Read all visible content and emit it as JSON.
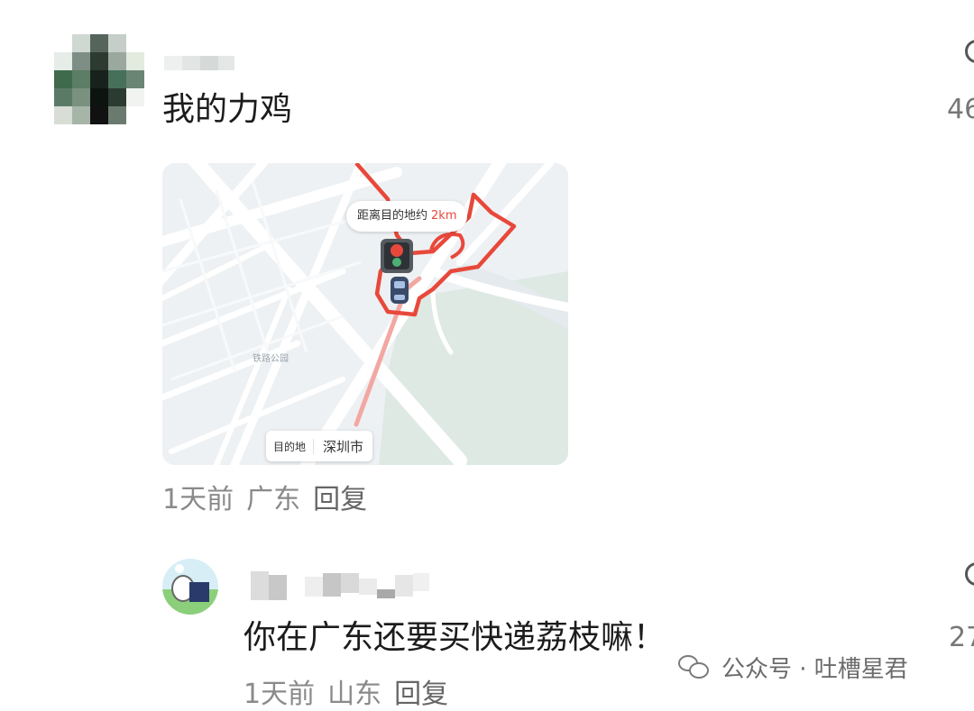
{
  "comments": [
    {
      "text": "我的力鸡",
      "like_count": "46",
      "meta": {
        "time": "1天前",
        "location": "广东",
        "reply": "回复"
      },
      "map": {
        "distance_label": "距离目的地约",
        "distance_value": "2km",
        "destination_key": "目的地",
        "destination_value": "深圳市",
        "place_labels": [
          "铁路公园"
        ],
        "route_color": "#e8483b"
      }
    },
    {
      "text": "你在广东还要买快递荔枝嘛！",
      "like_count": "27",
      "meta": {
        "time": "1天前",
        "location": "山东",
        "reply": "回复"
      }
    }
  ],
  "watermark": {
    "text": "公众号 · 吐槽星君",
    "icon": "wechat-icon"
  }
}
